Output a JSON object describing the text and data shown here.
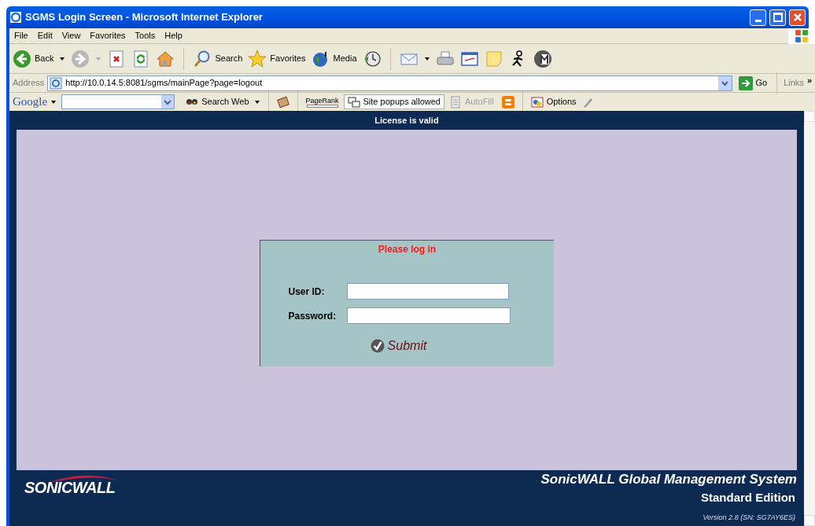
{
  "window": {
    "title": "SGMS Login Screen - Microsoft Internet Explorer"
  },
  "menu": [
    "File",
    "Edit",
    "View",
    "Favorites",
    "Tools",
    "Help"
  ],
  "toolbar": [
    {
      "kind": "back",
      "label": "Back"
    },
    {
      "kind": "forward"
    },
    {
      "kind": "stop"
    },
    {
      "kind": "refresh"
    },
    {
      "kind": "home"
    },
    {
      "kind": "search",
      "label": "Search"
    },
    {
      "kind": "favorites",
      "label": "Favorites"
    },
    {
      "kind": "media",
      "label": "Media"
    },
    {
      "kind": "history"
    },
    {
      "kind": "mail"
    },
    {
      "kind": "print"
    },
    {
      "kind": "edit"
    },
    {
      "kind": "note"
    },
    {
      "kind": "runner"
    },
    {
      "kind": "m"
    }
  ],
  "address_bar": {
    "label": "Address",
    "value": "http://10.0.14.5:8081/sgms/mainPage?page=logout",
    "go": "Go",
    "links": "Links",
    "more": "»"
  },
  "google_bar": {
    "logo": "Google",
    "search_web": "Search Web",
    "pagerank": "PageRank",
    "popups": "Site popups allowed",
    "autofill": {
      "label": "AutoFill",
      "disabled": true
    },
    "options": "Options"
  },
  "page": {
    "header": "License is valid",
    "login": {
      "title": "Please log in",
      "fields": [
        {
          "label": "User ID:"
        },
        {
          "label": "Password:"
        }
      ],
      "submit": "Submit"
    },
    "footer": {
      "logo": "SONICWALL",
      "product": "SonicWALL Global Management System",
      "edition": "Standard Edition",
      "version": "Version 2.8 (SN: SG7AY6ES)"
    }
  }
}
